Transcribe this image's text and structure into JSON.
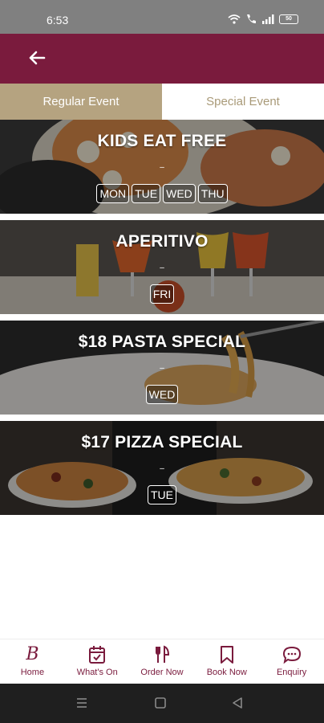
{
  "status_bar": {
    "time": "6:53",
    "battery": "50"
  },
  "tabs": [
    {
      "label": "Regular Event",
      "active": true
    },
    {
      "label": "Special Event",
      "active": false
    }
  ],
  "events": [
    {
      "title": "KIDS EAT FREE",
      "separator": "–",
      "days": [
        "MON",
        "TUE",
        "WED",
        "THU"
      ]
    },
    {
      "title": "APERITIVO",
      "separator": "–",
      "days": [
        "FRI"
      ]
    },
    {
      "title": "$18 PASTA SPECIAL",
      "separator": "–",
      "days": [
        "WED"
      ]
    },
    {
      "title": "$17 PIZZA SPECIAL",
      "separator": "–",
      "days": [
        "TUE"
      ]
    }
  ],
  "bottom_nav": [
    {
      "label": "Home",
      "icon": "brand-logo-icon"
    },
    {
      "label": "What's On",
      "icon": "calendar-icon"
    },
    {
      "label": "Order Now",
      "icon": "cutlery-icon"
    },
    {
      "label": "Book Now",
      "icon": "bookmark-icon"
    },
    {
      "label": "Enquiry",
      "icon": "chat-bubble-icon"
    }
  ],
  "colors": {
    "brand": "#7a1b3d",
    "tab_active": "#b5a380",
    "tab_inactive_text": "#a99a78"
  }
}
